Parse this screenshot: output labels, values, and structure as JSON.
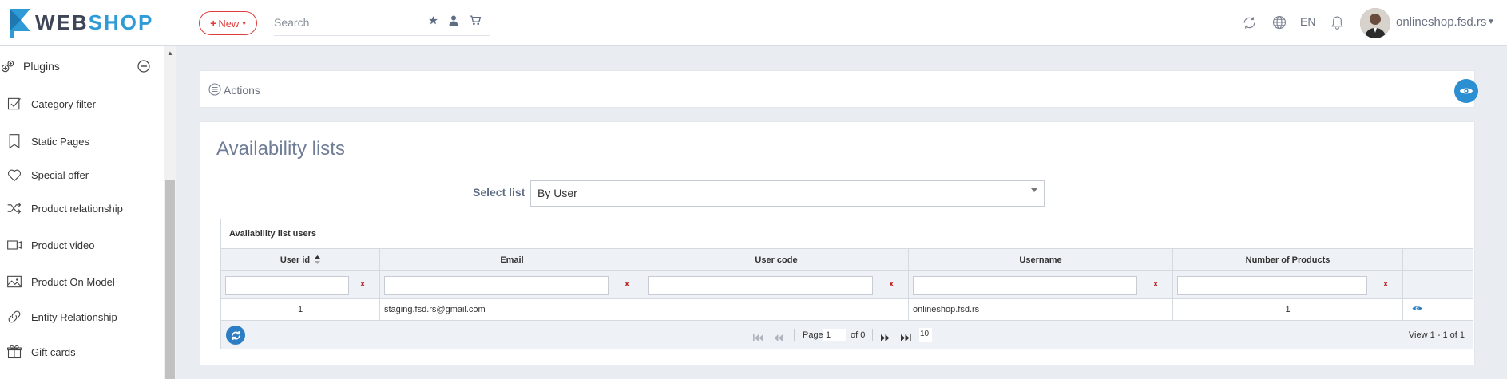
{
  "header": {
    "logo_web": "WEB",
    "logo_shop": "SHOP",
    "new_label": "New",
    "search_placeholder": "Search",
    "language": "EN",
    "user": "onlineshop.fsd.rs"
  },
  "sidebar": {
    "section": "Plugins",
    "items": [
      {
        "label": "Category filter",
        "icon": "checkbox-icon"
      },
      {
        "label": "Static Pages",
        "icon": "bookmark-icon"
      },
      {
        "label": "Special offer",
        "icon": "heart-icon"
      },
      {
        "label": "Product relationship",
        "icon": "shuffle-icon"
      },
      {
        "label": "Product video",
        "icon": "video-icon"
      },
      {
        "label": "Product On Model",
        "icon": "image-icon"
      },
      {
        "label": "Entity Relationship",
        "icon": "link-icon"
      },
      {
        "label": "Gift cards",
        "icon": "gift-icon"
      }
    ]
  },
  "actions": {
    "label": "Actions"
  },
  "panel": {
    "title": "Availability lists",
    "select_label": "Select list",
    "select_value": "By User"
  },
  "grid": {
    "caption": "Availability list users",
    "columns": [
      "User id",
      "Email",
      "User code",
      "Username",
      "Number of Products"
    ],
    "filter_clear": "x",
    "rows": [
      {
        "user_id": "1",
        "email": "staging.fsd.rs@gmail.com",
        "user_code": "",
        "username": "onlineshop.fsd.rs",
        "num_products": "1"
      }
    ],
    "pager": {
      "page_label": "Page",
      "page_value": "1",
      "of_label": "of 0",
      "page_size": "10",
      "view_count": "View 1 - 1 of 1"
    }
  },
  "colors": {
    "accent_blue": "#2c8fd1",
    "new_red": "#e03c3c",
    "title": "#6f7d96"
  }
}
